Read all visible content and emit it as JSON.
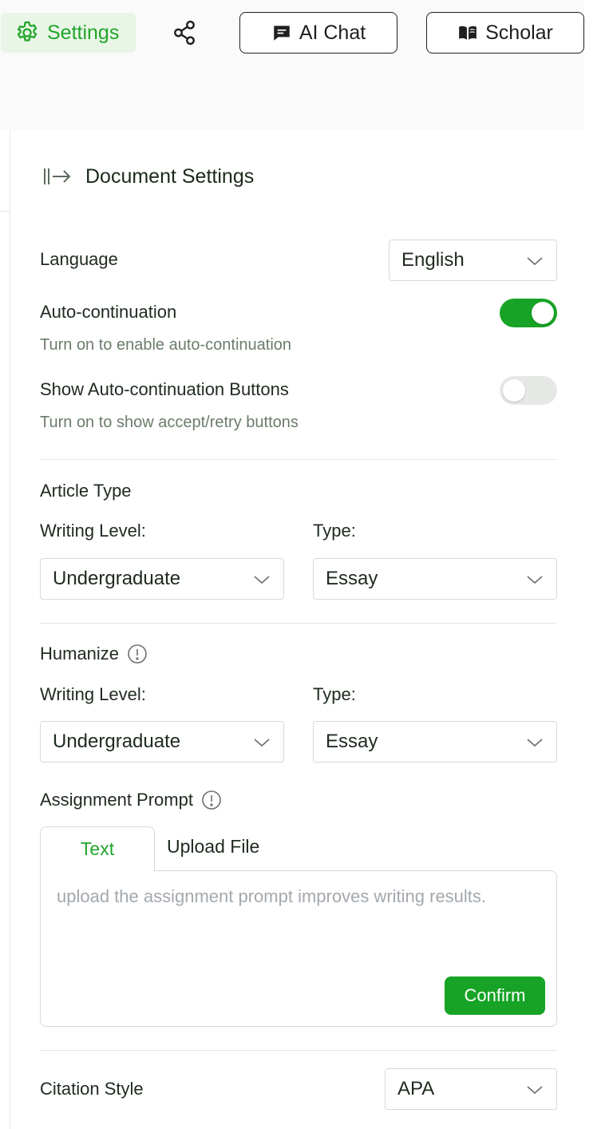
{
  "toolbar": {
    "settings_label": "Settings",
    "ai_chat_label": "AI Chat",
    "scholar_label": "Scholar"
  },
  "panel": {
    "title": "Document Settings"
  },
  "language": {
    "label": "Language",
    "value": "English"
  },
  "auto_continuation": {
    "label": "Auto-continuation",
    "hint": "Turn on to enable auto-continuation",
    "enabled": true
  },
  "auto_continuation_buttons": {
    "label": "Show Auto-continuation Buttons",
    "hint": "Turn on to show accept/retry buttons",
    "enabled": false
  },
  "article_type": {
    "heading": "Article Type",
    "writing_level_label": "Writing Level:",
    "writing_level_value": "Undergraduate",
    "type_label": "Type:",
    "type_value": "Essay"
  },
  "humanize": {
    "heading": "Humanize",
    "writing_level_label": "Writing Level:",
    "writing_level_value": "Undergraduate",
    "type_label": "Type:",
    "type_value": "Essay"
  },
  "assignment_prompt": {
    "heading": "Assignment Prompt",
    "tabs": [
      "Text",
      "Upload File"
    ],
    "active_tab": "Text",
    "placeholder": "upload the assignment prompt improves writing results.",
    "value": "",
    "confirm_label": "Confirm"
  },
  "citation": {
    "label": "Citation Style",
    "value": "APA"
  },
  "colors": {
    "accent": "#17a325",
    "accent_light": "#e9f6e7",
    "hint_text": "#6b7c6b",
    "border": "#d6dad6"
  },
  "icons": {
    "settings": "gear-icon",
    "share": "share-icon",
    "chat": "chat-bubble-icon",
    "scholar": "open-book-icon",
    "collapse": "collapse-panel-icon",
    "dropdown": "chevron-down-icon",
    "info": "info-circle-icon"
  }
}
